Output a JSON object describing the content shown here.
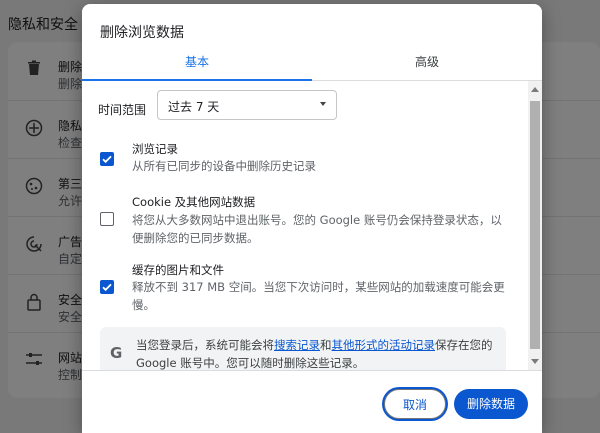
{
  "background": {
    "heading": "隐私和安全",
    "rows": [
      {
        "icon": "trash-icon",
        "t1": "删除",
        "t2": "删除"
      },
      {
        "icon": "privacy-guide-icon",
        "t1": "隐私",
        "t2": "检查"
      },
      {
        "icon": "cookie-icon",
        "t1": "第三",
        "t2": "允许"
      },
      {
        "icon": "ads-icon",
        "t1": "广告",
        "t2": "自定"
      },
      {
        "icon": "lock-icon",
        "t1": "安全",
        "t2": "安全"
      },
      {
        "icon": "sliders-icon",
        "t1": "网站",
        "t2": "控制"
      }
    ]
  },
  "dialog": {
    "title": "删除浏览数据",
    "tabs": [
      {
        "label": "基本",
        "active": true
      },
      {
        "label": "高级",
        "active": false
      }
    ],
    "time_range": {
      "label": "时间范围",
      "value": "过去 7 天"
    },
    "options": [
      {
        "title": "浏览记录",
        "desc": "从所有已同步的设备中删除历史记录",
        "checked": true
      },
      {
        "title": "Cookie 及其他网站数据",
        "desc": "将您从大多数网站中退出账号。您的 Google 账号仍会保持登录状态，以便删除您的已同步数据。",
        "checked": false
      },
      {
        "title": "缓存的图片和文件",
        "desc": "释放不到 317 MB 空间。当您下次访问时，某些网站的加载速度可能会更慢。",
        "checked": true
      }
    ],
    "info": {
      "icon": "google-g-icon",
      "prefix": "当您登录后，系统可能会将",
      "link1": "搜索记录",
      "middle": "和",
      "link2": "其他形式的活动记录",
      "suffix": "保存在您的 Google 账号中。您可以随时删除这些记录。"
    },
    "buttons": {
      "cancel": "取消",
      "confirm": "删除数据"
    }
  },
  "colors": {
    "accent": "#0b57d0",
    "tab_accent": "#1a73e8"
  }
}
